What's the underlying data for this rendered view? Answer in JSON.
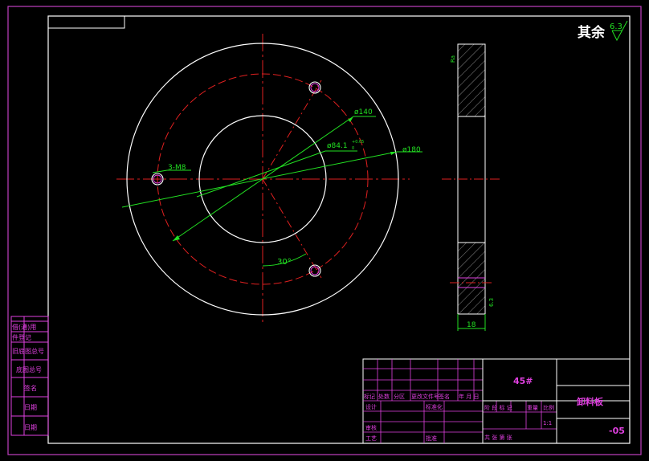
{
  "surface_finish": {
    "prefix": "其余",
    "value": "6.3"
  },
  "dimensions": {
    "d140": "ø140",
    "d84": "ø84.1",
    "d84_tol_upper": "+0.05",
    "d84_tol_lower": "0",
    "d180": "ø180",
    "thread": "3-M8",
    "angle": "30°",
    "thickness": "18",
    "side_top": "Ra",
    "side_bottom": "6.3"
  },
  "left_stamp": [
    "借(通)用",
    "件登记",
    "旧底图总号",
    "底图总号",
    "签名",
    "日期",
    "日期"
  ],
  "title_block": {
    "material": "45#",
    "part_name": "卸料板",
    "drawing_no": "-05",
    "header_row": [
      "标记",
      "处数",
      "分区",
      "更改文件号",
      "签名",
      "年 月 日"
    ],
    "design": "设计",
    "standardization": "标准化",
    "review": "审核",
    "process": "工艺",
    "approve": "批准",
    "stage_row": [
      "阶 段 标 记",
      "重量",
      "比例"
    ],
    "scale": "1:1",
    "sheet_row": "共   张   第   张"
  }
}
